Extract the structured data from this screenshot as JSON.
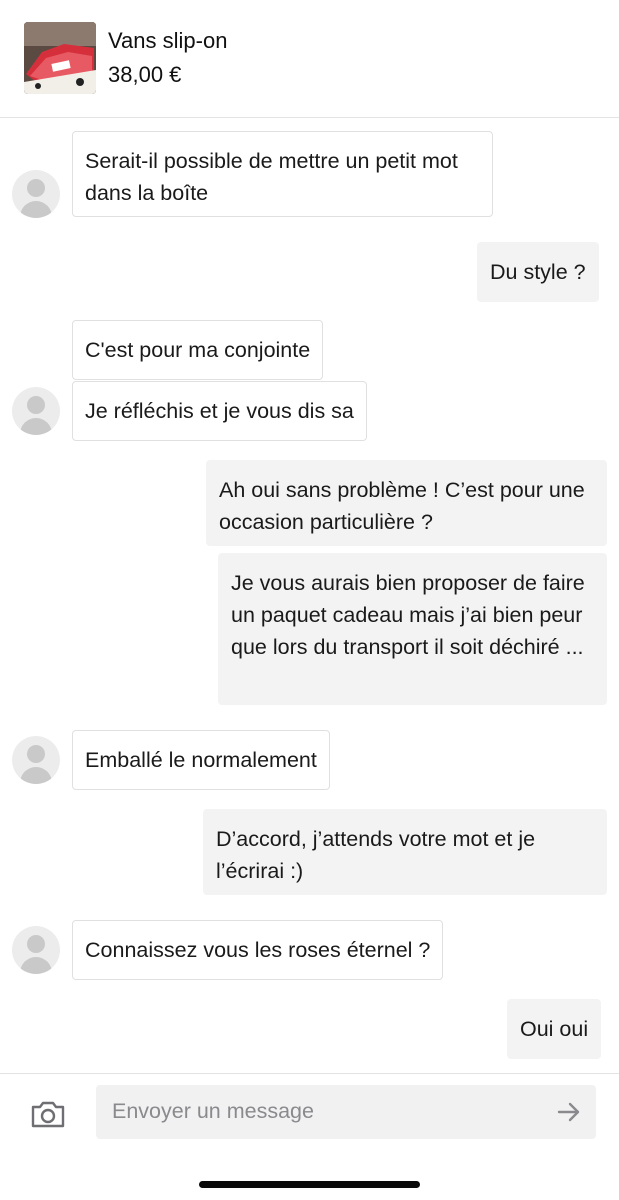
{
  "header": {
    "product_title": "Vans slip-on",
    "product_price": "38,00 €"
  },
  "messages": [
    {
      "direction": "in",
      "text": "Serait-il possible de mettre un petit mot dans la boîte"
    },
    {
      "direction": "out",
      "text": "Du style ?"
    },
    {
      "direction": "in",
      "text": "C'est pour ma conjointe"
    },
    {
      "direction": "in",
      "text": "Je réfléchis et je vous dis sa"
    },
    {
      "direction": "out",
      "text": "Ah oui sans problème ! C’est pour une occasion particulière ?"
    },
    {
      "direction": "out",
      "text": "Je vous aurais bien proposer de faire un paquet cadeau mais j’ai bien peur que lors du transport il soit déchiré ..."
    },
    {
      "direction": "in",
      "text": "Emballé le normalement"
    },
    {
      "direction": "out",
      "text": "D’accord, j’attends votre mot et je l’écrirai :)"
    },
    {
      "direction": "in",
      "text": "Connaissez vous les roses éternel ?"
    },
    {
      "direction": "out",
      "text": "Oui oui"
    }
  ],
  "composer": {
    "placeholder": "Envoyer un message",
    "camera_icon": "camera-icon",
    "send_icon": "arrow-right-icon"
  },
  "colors": {
    "outgoing_bubble": "#f3f3f4",
    "incoming_border": "#e0e0e0",
    "placeholder": "#8a8a8e"
  }
}
